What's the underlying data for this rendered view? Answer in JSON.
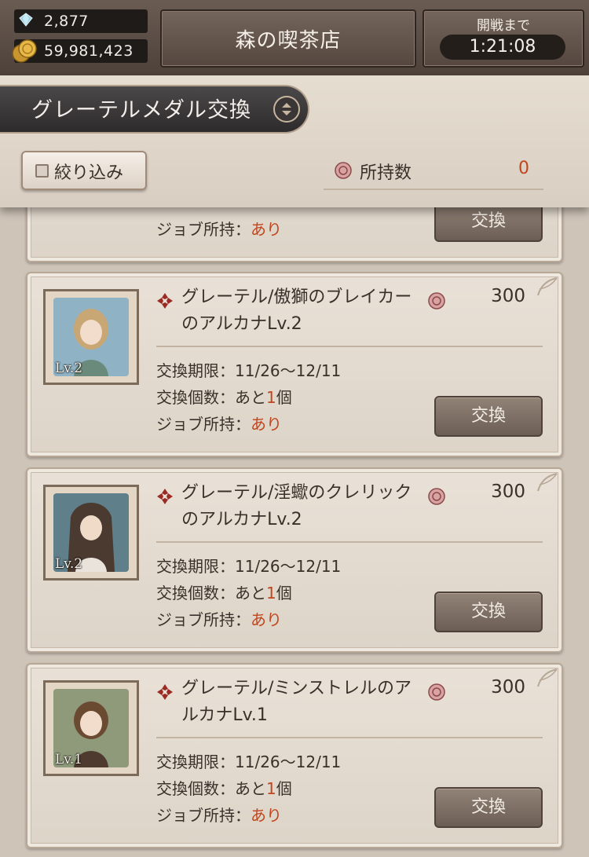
{
  "status": {
    "gems": "2,877",
    "gold": "59,981,423",
    "store_name": "森の喫茶店",
    "battle_label": "開戦まで",
    "battle_timer": "1:21:08"
  },
  "header": {
    "title": "グレーテルメダル交換",
    "filter_label": "絞り込み",
    "holdings_label": "所持数",
    "holdings_count": "0"
  },
  "partial_item": {
    "job_label": "ジョブ所持：",
    "job_value": "あり",
    "exchange_label": "交換"
  },
  "items": [
    {
      "level": "Lv.2",
      "name": "グレーテル/傲獅のブレイカーのアルカナLv.2",
      "price": "300",
      "period_label": "交換期限：",
      "period_value": "11/26〜12/11",
      "count_label": "交換個数：あと",
      "count_value": "1",
      "count_unit": "個",
      "job_label": "ジョブ所持：",
      "job_value": "あり",
      "exchange_label": "交換"
    },
    {
      "level": "Lv.2",
      "name": "グレーテル/淫蠍のクレリックのアルカナLv.2",
      "price": "300",
      "period_label": "交換期限：",
      "period_value": "11/26〜12/11",
      "count_label": "交換個数：あと",
      "count_value": "1",
      "count_unit": "個",
      "job_label": "ジョブ所持：",
      "job_value": "あり",
      "exchange_label": "交換"
    },
    {
      "level": "Lv.1",
      "name": "グレーテル/ミンストレルのアルカナLv.1",
      "price": "300",
      "period_label": "交換期限：",
      "period_value": "11/26〜12/11",
      "count_label": "交換個数：あと",
      "count_value": "1",
      "count_unit": "個",
      "job_label": "ジョブ所持：",
      "job_value": "あり",
      "exchange_label": "交換"
    }
  ],
  "colors": {
    "accent_red": "#c0461e",
    "panel_bg": "#e9e1d7",
    "button_bg": "#7f7066"
  }
}
